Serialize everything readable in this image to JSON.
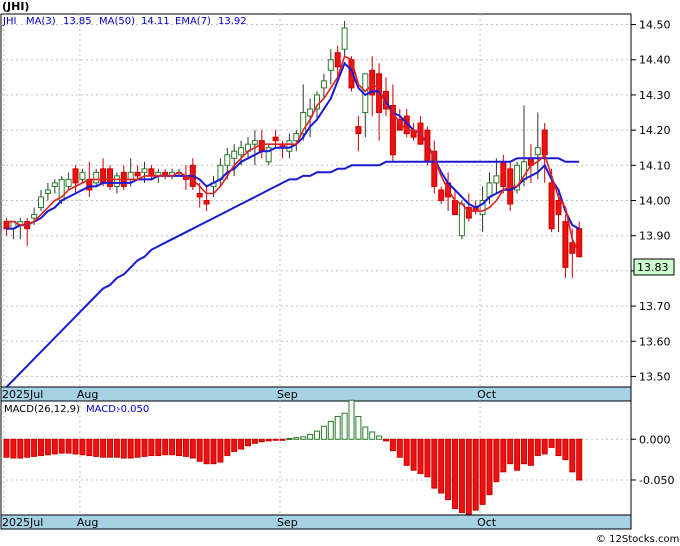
{
  "chart_data": [
    {
      "type": "candlestick",
      "title": "(JHI)",
      "ticker": "JHI",
      "legend": [
        {
          "label": "MA(3)",
          "value": "13.85",
          "color": "#dd0000"
        },
        {
          "label": "MA(50)",
          "value": "14.11",
          "color": "#0000cc"
        },
        {
          "label": "EMA(7)",
          "value": "13.92",
          "color": "#0000ff"
        }
      ],
      "y_ticks": [
        "14.50",
        "14.40",
        "14.30",
        "14.20",
        "14.10",
        "14.00",
        "13.90",
        "13.80",
        "13.70",
        "13.60",
        "13.50"
      ],
      "ylim": [
        13.47,
        14.53
      ],
      "x_labels": [
        "2025Jul",
        "Aug",
        "Sep",
        "Oct"
      ],
      "current_price_label": "13.83",
      "grid": true,
      "candles": [
        [
          13.94,
          13.95,
          13.9,
          13.92
        ],
        [
          13.92,
          13.94,
          13.89,
          13.94
        ],
        [
          13.93,
          13.95,
          13.89,
          13.94
        ],
        [
          13.94,
          13.95,
          13.87,
          13.92
        ],
        [
          13.95,
          13.98,
          13.93,
          13.96
        ],
        [
          13.98,
          14.03,
          13.97,
          14.01
        ],
        [
          14.02,
          14.05,
          14.0,
          14.03
        ],
        [
          14.04,
          14.06,
          14.02,
          14.05
        ],
        [
          14.0,
          14.07,
          13.99,
          14.06
        ],
        [
          14.04,
          14.08,
          14.03,
          14.06
        ],
        [
          14.09,
          14.1,
          14.02,
          14.05
        ],
        [
          14.06,
          14.09,
          14.05,
          14.08
        ],
        [
          14.06,
          14.11,
          14.01,
          14.03
        ],
        [
          14.05,
          14.09,
          14.04,
          14.08
        ],
        [
          14.09,
          14.12,
          14.04,
          14.05
        ],
        [
          14.09,
          14.1,
          14.03,
          14.04
        ],
        [
          14.04,
          14.08,
          14.02,
          14.07
        ],
        [
          14.08,
          14.1,
          14.03,
          14.04
        ],
        [
          14.06,
          14.12,
          14.04,
          14.08
        ],
        [
          14.08,
          14.1,
          14.06,
          14.07
        ],
        [
          14.08,
          14.11,
          14.05,
          14.09
        ],
        [
          14.09,
          14.1,
          14.06,
          14.07
        ],
        [
          14.07,
          14.09,
          14.05,
          14.08
        ],
        [
          14.08,
          14.09,
          14.06,
          14.07
        ],
        [
          14.07,
          14.09,
          14.06,
          14.08
        ],
        [
          14.08,
          14.09,
          14.07,
          14.08
        ],
        [
          14.07,
          14.1,
          14.03,
          14.06
        ],
        [
          14.1,
          14.12,
          14.03,
          14.04
        ],
        [
          14.02,
          14.05,
          13.98,
          14.01
        ],
        [
          14.0,
          14.04,
          13.97,
          13.99
        ],
        [
          14.04,
          14.07,
          14.01,
          14.05
        ],
        [
          14.06,
          14.12,
          14.04,
          14.1
        ],
        [
          14.1,
          14.15,
          14.06,
          14.13
        ],
        [
          14.12,
          14.16,
          14.07,
          14.14
        ],
        [
          14.13,
          14.17,
          14.1,
          14.15
        ],
        [
          14.14,
          14.18,
          14.12,
          14.16
        ],
        [
          14.16,
          14.2,
          14.1,
          14.17
        ],
        [
          14.17,
          14.2,
          14.12,
          14.14
        ],
        [
          14.11,
          14.16,
          14.1,
          14.15
        ],
        [
          14.18,
          14.2,
          14.15,
          14.17
        ],
        [
          14.16,
          14.17,
          14.12,
          14.15
        ],
        [
          14.14,
          14.19,
          14.12,
          14.17
        ],
        [
          14.17,
          14.2,
          14.14,
          14.19
        ],
        [
          14.19,
          14.33,
          14.17,
          14.25
        ],
        [
          14.24,
          14.29,
          14.18,
          14.26
        ],
        [
          14.26,
          14.31,
          14.23,
          14.3
        ],
        [
          14.32,
          14.36,
          14.29,
          14.34
        ],
        [
          14.37,
          14.43,
          14.33,
          14.4
        ],
        [
          14.42,
          14.44,
          14.35,
          14.38
        ],
        [
          14.43,
          14.51,
          14.41,
          14.49
        ],
        [
          14.4,
          14.41,
          14.31,
          14.32
        ],
        [
          14.21,
          14.24,
          14.14,
          14.19
        ],
        [
          14.25,
          14.35,
          14.18,
          14.36
        ],
        [
          14.37,
          14.41,
          14.24,
          14.3
        ],
        [
          14.36,
          14.39,
          14.17,
          14.25
        ],
        [
          14.31,
          14.35,
          14.24,
          14.26
        ],
        [
          14.27,
          14.33,
          14.11,
          14.13
        ],
        [
          14.23,
          14.26,
          14.2,
          14.2
        ],
        [
          14.24,
          14.26,
          14.18,
          14.19
        ],
        [
          14.2,
          14.22,
          14.17,
          14.18
        ],
        [
          14.22,
          14.24,
          14.19,
          14.16
        ],
        [
          14.2,
          14.21,
          14.1,
          14.11
        ],
        [
          14.14,
          14.17,
          14.02,
          14.04
        ],
        [
          14.03,
          14.04,
          13.99,
          14.0
        ],
        [
          14.05,
          14.08,
          13.97,
          14.01
        ],
        [
          14.0,
          14.03,
          13.98,
          13.96
        ],
        [
          13.9,
          14.0,
          13.89,
          13.99
        ],
        [
          13.98,
          14.02,
          13.94,
          13.95
        ],
        [
          13.98,
          14.0,
          13.96,
          13.97
        ],
        [
          13.96,
          14.04,
          13.91,
          14.0
        ],
        [
          14.01,
          14.08,
          13.99,
          14.05
        ],
        [
          14.05,
          14.12,
          14.02,
          14.07
        ],
        [
          14.11,
          14.13,
          14.02,
          14.04
        ],
        [
          14.09,
          14.11,
          13.97,
          13.99
        ],
        [
          14.03,
          14.11,
          14.02,
          14.1
        ],
        [
          14.06,
          14.27,
          14.04,
          14.11
        ],
        [
          14.12,
          14.16,
          14.05,
          14.1
        ],
        [
          14.13,
          14.25,
          14.06,
          14.15
        ],
        [
          14.2,
          14.22,
          14.05,
          14.13
        ],
        [
          14.05,
          14.09,
          13.91,
          13.92
        ],
        [
          14.0,
          14.02,
          13.91,
          13.96
        ],
        [
          13.94,
          13.96,
          13.78,
          13.81
        ],
        [
          13.88,
          13.92,
          13.78,
          13.85
        ],
        [
          13.92,
          13.94,
          13.84,
          13.84
        ]
      ],
      "ma3": [
        13.94,
        13.94,
        13.93,
        13.93,
        13.94,
        13.96,
        13.98,
        14.0,
        14.01,
        14.03,
        14.04,
        14.05,
        14.06,
        14.06,
        14.06,
        14.06,
        14.06,
        14.06,
        14.06,
        14.06,
        14.07,
        14.07,
        14.07,
        14.07,
        14.07,
        14.08,
        14.07,
        14.06,
        14.04,
        14.02,
        14.02,
        14.04,
        14.07,
        14.1,
        14.12,
        14.14,
        14.15,
        14.16,
        14.16,
        14.16,
        14.16,
        14.16,
        14.16,
        14.2,
        14.23,
        14.27,
        14.29,
        14.32,
        14.35,
        14.41,
        14.4,
        14.33,
        14.31,
        14.33,
        14.32,
        14.27,
        14.25,
        14.22,
        14.2,
        14.2,
        14.19,
        14.16,
        14.12,
        14.07,
        14.03,
        14.0,
        13.99,
        13.97,
        13.97,
        13.97,
        13.98,
        14.0,
        14.03,
        14.04,
        14.04,
        14.07,
        14.1,
        14.11,
        14.13,
        14.07,
        14.01,
        13.98,
        13.89,
        13.85
      ],
      "ma50": [
        13.47,
        13.49,
        13.51,
        13.53,
        13.55,
        13.57,
        13.59,
        13.61,
        13.63,
        13.65,
        13.67,
        13.69,
        13.71,
        13.73,
        13.75,
        13.76,
        13.78,
        13.79,
        13.81,
        13.83,
        13.84,
        13.86,
        13.87,
        13.88,
        13.89,
        13.9,
        13.91,
        13.92,
        13.93,
        13.94,
        13.95,
        13.96,
        13.97,
        13.98,
        13.99,
        14.0,
        14.01,
        14.02,
        14.03,
        14.04,
        14.05,
        14.06,
        14.06,
        14.07,
        14.07,
        14.08,
        14.08,
        14.08,
        14.09,
        14.09,
        14.1,
        14.1,
        14.1,
        14.1,
        14.1,
        14.11,
        14.11,
        14.11,
        14.11,
        14.11,
        14.11,
        14.11,
        14.11,
        14.11,
        14.11,
        14.11,
        14.11,
        14.11,
        14.11,
        14.11,
        14.11,
        14.11,
        14.11,
        14.11,
        14.12,
        14.12,
        14.12,
        14.12,
        14.12,
        14.12,
        14.12,
        14.11,
        14.11,
        14.11
      ],
      "ema7": [
        13.92,
        13.92,
        13.93,
        13.93,
        13.94,
        13.95,
        13.97,
        13.98,
        14.0,
        14.01,
        14.02,
        14.03,
        14.04,
        14.04,
        14.05,
        14.05,
        14.05,
        14.05,
        14.05,
        14.06,
        14.06,
        14.06,
        14.07,
        14.07,
        14.07,
        14.07,
        14.07,
        14.07,
        14.06,
        14.04,
        14.05,
        14.06,
        14.08,
        14.09,
        14.11,
        14.12,
        14.13,
        14.14,
        14.14,
        14.15,
        14.15,
        14.15,
        14.16,
        14.18,
        14.21,
        14.23,
        14.26,
        14.29,
        14.34,
        14.39,
        14.37,
        14.32,
        14.3,
        14.31,
        14.31,
        14.28,
        14.25,
        14.24,
        14.22,
        14.2,
        14.19,
        14.16,
        14.12,
        14.08,
        14.05,
        14.03,
        14.01,
        13.99,
        13.98,
        13.99,
        14.01,
        14.02,
        14.03,
        14.03,
        14.04,
        14.06,
        14.07,
        14.08,
        14.1,
        14.06,
        14.03,
        13.97,
        13.93,
        13.92
      ]
    },
    {
      "type": "bar",
      "title": "MACD(26,12,9)",
      "legend": [
        {
          "label": "MACD:",
          "value": "-0.050",
          "color": "#0000cc"
        }
      ],
      "y_ticks": [
        "0.000",
        "-0.050"
      ],
      "ylim": [
        -0.093,
        0.047
      ],
      "x_labels": [
        "2025Jul",
        "Aug",
        "Sep",
        "Oct"
      ],
      "grid": true,
      "values": [
        -0.022,
        -0.023,
        -0.023,
        -0.022,
        -0.021,
        -0.02,
        -0.019,
        -0.018,
        -0.017,
        -0.017,
        -0.018,
        -0.019,
        -0.02,
        -0.021,
        -0.022,
        -0.022,
        -0.022,
        -0.023,
        -0.023,
        -0.022,
        -0.021,
        -0.02,
        -0.02,
        -0.019,
        -0.019,
        -0.02,
        -0.021,
        -0.023,
        -0.027,
        -0.03,
        -0.03,
        -0.028,
        -0.02,
        -0.015,
        -0.012,
        -0.008,
        -0.005,
        -0.003,
        -0.002,
        -0.001,
        -0.001,
        0.001,
        0.002,
        0.003,
        0.006,
        0.01,
        0.016,
        0.022,
        0.028,
        0.032,
        0.048,
        0.028,
        0.015,
        0.009,
        0.004,
        -0.002,
        -0.014,
        -0.022,
        -0.032,
        -0.038,
        -0.042,
        -0.046,
        -0.06,
        -0.066,
        -0.074,
        -0.085,
        -0.09,
        -0.092,
        -0.087,
        -0.08,
        -0.068,
        -0.052,
        -0.04,
        -0.03,
        -0.038,
        -0.03,
        -0.032,
        -0.02,
        -0.018,
        -0.01,
        -0.02,
        -0.025,
        -0.04,
        -0.05
      ]
    }
  ],
  "credit": "© 12Stocks.com"
}
